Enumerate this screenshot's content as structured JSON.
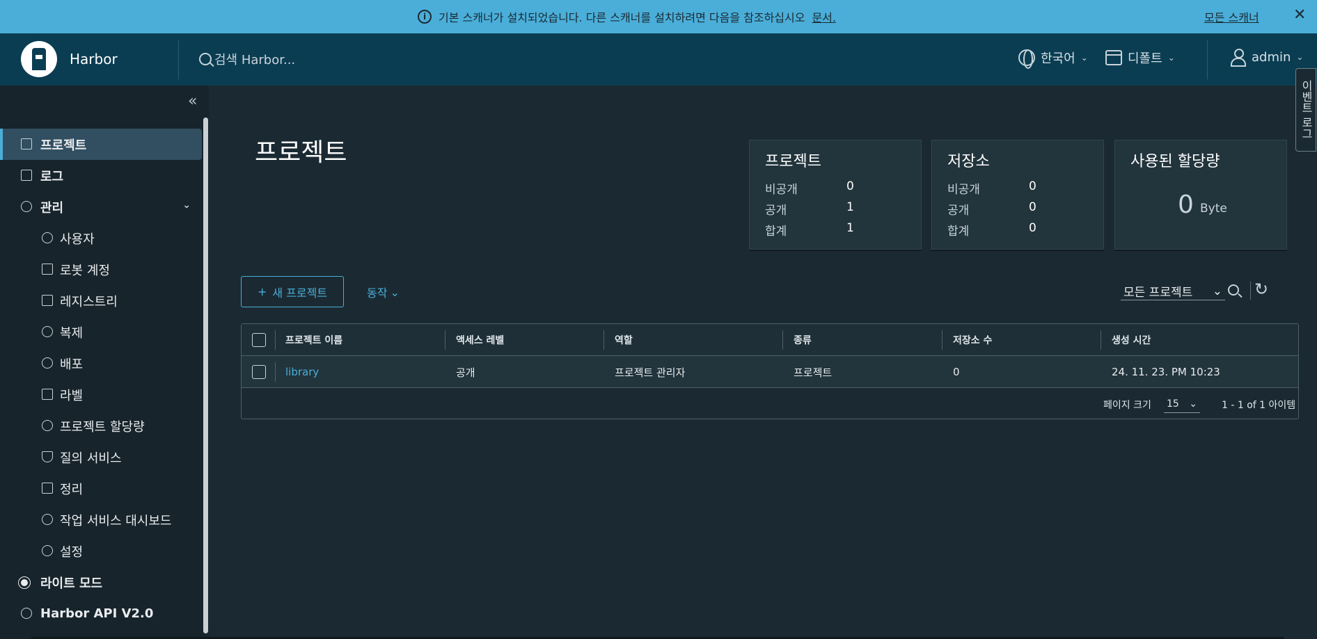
{
  "banner": {
    "message": "기본 스캐너가 설치되었습니다. 다른 스캐너를 설치하려면 다음을 참조하십시오",
    "doc_link": "문서.",
    "all_scanners": "모든 스캐너",
    "close": "✕",
    "color": "#4aaed9"
  },
  "header": {
    "brand": "Harbor",
    "search_placeholder": "검색 Harbor...",
    "language": "한국어",
    "datetime": "디폴트",
    "user": "admin",
    "background": "#0b3d52"
  },
  "event_tab": "이벤트 로그",
  "sidebar": {
    "collapse": "«",
    "items": [
      {
        "label": "프로젝트",
        "icon": "projects-icon",
        "active": true
      },
      {
        "label": "로그",
        "icon": "logs-icon"
      },
      {
        "label": "관리",
        "icon": "admin-icon",
        "expandable": true
      },
      {
        "label": "사용자",
        "icon": "users-icon"
      },
      {
        "label": "로봇 계정",
        "icon": "robot-icon"
      },
      {
        "label": "레지스트리",
        "icon": "registry-icon"
      },
      {
        "label": "복제",
        "icon": "replication-icon"
      },
      {
        "label": "배포",
        "icon": "distribution-icon"
      },
      {
        "label": "라벨",
        "icon": "label-icon"
      },
      {
        "label": "프로젝트 할당량",
        "icon": "quota-icon"
      },
      {
        "label": "질의 서비스",
        "icon": "shield-icon"
      },
      {
        "label": "정리",
        "icon": "trash-icon"
      },
      {
        "label": "작업 서비스 대시보드",
        "icon": "dashboard-icon"
      },
      {
        "label": "설정",
        "icon": "gear-icon"
      },
      {
        "label": "라이트 모드",
        "icon": "sun-icon"
      },
      {
        "label": "Harbor API V2.0",
        "icon": "api-icon"
      }
    ]
  },
  "main": {
    "title": "프로젝트",
    "cards": {
      "projects": {
        "title": "프로젝트",
        "private_label": "비공개",
        "private": "0",
        "public_label": "공개",
        "public": "1",
        "total_label": "합계",
        "total": "1"
      },
      "repos": {
        "title": "저장소",
        "private_label": "비공개",
        "private": "0",
        "public_label": "공개",
        "public": "0",
        "total_label": "합계",
        "total": "0"
      },
      "quota": {
        "title": "사용된 할당량",
        "value": "0",
        "unit": "Byte"
      }
    },
    "new_project": "새 프로젝트",
    "action": "동작",
    "filter": "모든 프로젝트",
    "table": {
      "headers": [
        "프로젝트 이름",
        "액세스 레벨",
        "역할",
        "종류",
        "저장소 수",
        "생성 시간"
      ],
      "rows": [
        {
          "name": "library",
          "access": "공개",
          "role": "프로젝트 관리자",
          "type": "프로젝트",
          "repo_count": "0",
          "created": "24. 11. 23. PM 10:23"
        }
      ],
      "page_size_label": "페이지 크기",
      "page_size": "15",
      "count": "1 - 1 of 1 아이템"
    }
  }
}
